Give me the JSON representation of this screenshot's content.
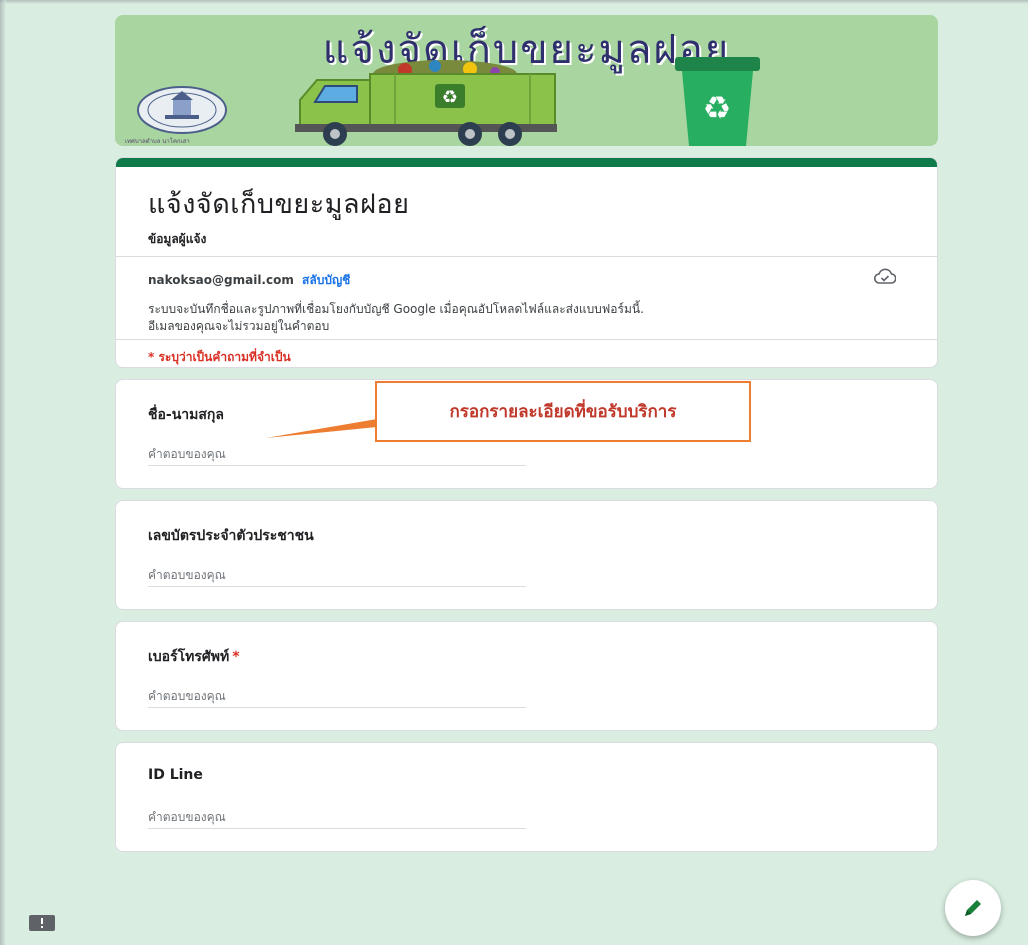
{
  "banner": {
    "title": "แจ้งจัดเก็บขยะมูลฝอย",
    "seal_caption": "เทศบาลตำบล นาโคกเสา"
  },
  "header": {
    "title": "แจ้งจัดเก็บขยะมูลฝอย",
    "description": "ข้อมูลผู้แจ้ง",
    "account_email": "nakoksao@gmail.com",
    "switch_account": "สลับบัญชี",
    "notice_line1": "ระบบจะบันทึกชื่อและรูปภาพที่เชื่อมโยงกับบัญชี Google เมื่อคุณอัปโหลดไฟล์และส่งแบบฟอร์มนี้.",
    "notice_line2": "อีเมลของคุณจะไม่รวมอยู่ในคำตอบ",
    "required_note": "* ระบุว่าเป็นคำถามที่จำเป็น"
  },
  "questions": [
    {
      "label": "ชื่อ-นามสกุล",
      "required": false,
      "placeholder": "คำตอบของคุณ"
    },
    {
      "label": "เลขบัตรประจำตัวประชาชน",
      "required": false,
      "placeholder": "คำตอบของคุณ"
    },
    {
      "label": "เบอร์โทรศัพท์",
      "required": true,
      "required_mark": "*",
      "placeholder": "คำตอบของคุณ"
    },
    {
      "label": "ID Line",
      "required": false,
      "placeholder": "คำตอบของคุณ"
    }
  ],
  "callout": {
    "text": "กรอกรายละเอียดที่ขอรับบริการ"
  },
  "colors": {
    "background": "#d9ede0",
    "banner": "#a8d5a0",
    "accent": "#0f7b4a",
    "required": "#d93025",
    "link": "#1a73e8",
    "callout_border": "#ed7d31",
    "callout_text": "#c0392b"
  },
  "icons": {
    "cloud": "cloud-check-icon",
    "feedback": "feedback-icon",
    "edit": "pencil-icon"
  }
}
